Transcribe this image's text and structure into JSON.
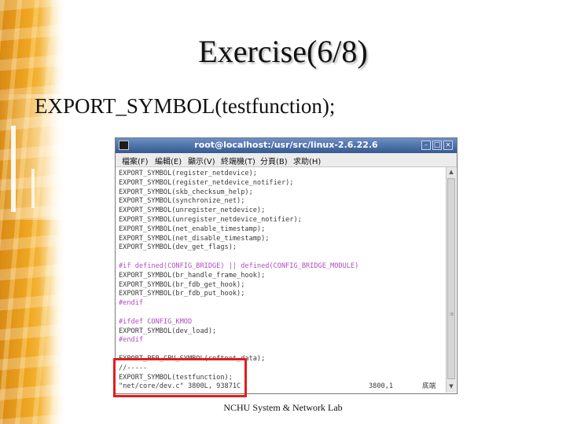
{
  "slide": {
    "title": "Exercise(6/8)",
    "subtitle": "EXPORT_SYMBOL(testfunction);",
    "footer": "NCHU System & Network Lab"
  },
  "terminal": {
    "title": "root@localhost:/usr/src/linux-2.6.22.6",
    "buttons": {
      "minimize": "–",
      "maximize": "□",
      "close": "×"
    },
    "menu": [
      "檔案(F)",
      "編輯(E)",
      "顯示(V)",
      "終端機(T)",
      "分頁(B)",
      "求助(H)"
    ],
    "lines": [
      {
        "text": "EXPORT_SYMBOL(register_netdevice);",
        "kind": "code"
      },
      {
        "text": "EXPORT_SYMBOL(register_netdevice_notifier);",
        "kind": "code"
      },
      {
        "text": "EXPORT_SYMBOL(skb_checksum_help);",
        "kind": "code"
      },
      {
        "text": "EXPORT_SYMBOL(synchronize_net);",
        "kind": "code"
      },
      {
        "text": "EXPORT_SYMBOL(unregister_netdevice);",
        "kind": "code"
      },
      {
        "text": "EXPORT_SYMBOL(unregister_netdevice_notifier);",
        "kind": "code"
      },
      {
        "text": "EXPORT_SYMBOL(net_enable_timestamp);",
        "kind": "code"
      },
      {
        "text": "EXPORT_SYMBOL(net_disable_timestamp);",
        "kind": "code"
      },
      {
        "text": "EXPORT_SYMBOL(dev_get_flags);",
        "kind": "code"
      },
      {
        "text": "",
        "kind": "code"
      },
      {
        "text": "#if defined(CONFIG_BRIDGE) || defined(CONFIG_BRIDGE_MODULE)",
        "kind": "pp"
      },
      {
        "text": "EXPORT_SYMBOL(br_handle_frame_hook);",
        "kind": "code"
      },
      {
        "text": "EXPORT_SYMBOL(br_fdb_get_hook);",
        "kind": "code"
      },
      {
        "text": "EXPORT_SYMBOL(br_fdb_put_hook);",
        "kind": "code"
      },
      {
        "text": "#endif",
        "kind": "pp"
      },
      {
        "text": "",
        "kind": "code"
      },
      {
        "text": "#ifdef CONFIG_KMOD",
        "kind": "pp"
      },
      {
        "text": "EXPORT_SYMBOL(dev_load);",
        "kind": "code"
      },
      {
        "text": "#endif",
        "kind": "pp"
      },
      {
        "text": "",
        "kind": "code"
      },
      {
        "text": "EXPORT_PER_CPU_SYMBOL(softnet_data);",
        "kind": "code"
      },
      {
        "text": "//-----",
        "kind": "code"
      },
      {
        "text": "EXPORT_SYMBOL(testfunction);",
        "kind": "code"
      },
      {
        "text": "\"net/core/dev.c\" 3800L, 93871C",
        "kind": "code"
      }
    ],
    "cursor_position": "3800,1",
    "scroll_position": "底端",
    "scrollbar_grip": "≡"
  },
  "colors": {
    "highlight_border": "#e01e1e",
    "preprocessor": "#b04cc0",
    "titlebar": "#4a6ea8"
  }
}
